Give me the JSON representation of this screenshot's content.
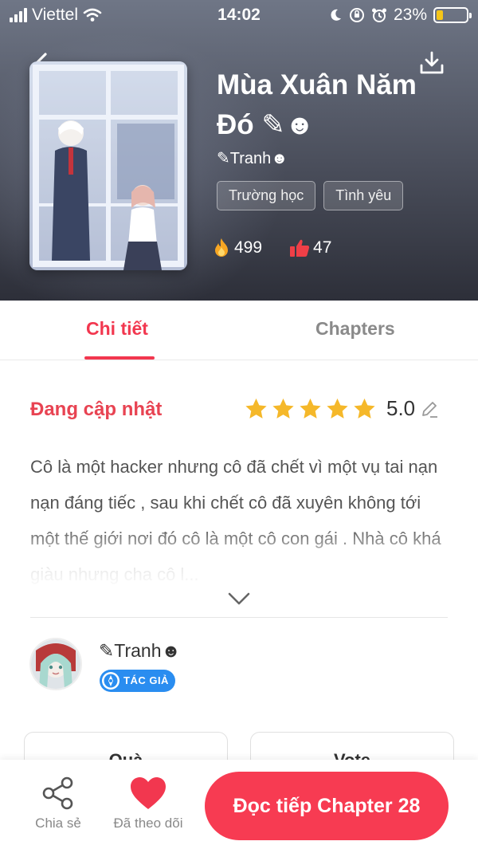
{
  "status_bar": {
    "carrier": "Viettel",
    "time": "14:02",
    "battery": "23%",
    "battery_level": 0.23
  },
  "story": {
    "title": "Mùa Xuân Năm Đó ✎☻",
    "author": "✎Tranh☻",
    "tags": [
      "Trường học",
      "Tình yêu"
    ],
    "views": "499",
    "likes": "47"
  },
  "tabs": [
    "Chi tiết",
    "Chapters"
  ],
  "detail": {
    "status": "Đang cập nhật",
    "rating": "5.0",
    "rating_stars": 5,
    "description": "Cô là một hacker nhưng cô đã chết vì một vụ tai nạn nạn đáng tiếc , sau khi chết cô đã xuyên không tới một thế giới nơi đó cô là một cô con gái . Nhà cô khá giàu nhưng cha cô l...",
    "author_name": "✎Tranh☻",
    "author_badge": "TÁC GIẢ",
    "cards": [
      "Quà",
      "Vote"
    ]
  },
  "bottom_bar": {
    "share_label": "Chia sẻ",
    "follow_label": "Đã theo dõi",
    "cta_label": "Đọc tiếp Chapter 28"
  },
  "colors": {
    "accent": "#f2374f",
    "cta": "#f73b52",
    "badge": "#2a8df0",
    "star": "#f5b82a"
  },
  "icons": [
    "back-arrow-icon",
    "download-icon",
    "fire-icon",
    "thumbs-up-icon",
    "star-icon",
    "pencil-icon",
    "chevron-down-icon",
    "share-icon",
    "heart-icon"
  ]
}
